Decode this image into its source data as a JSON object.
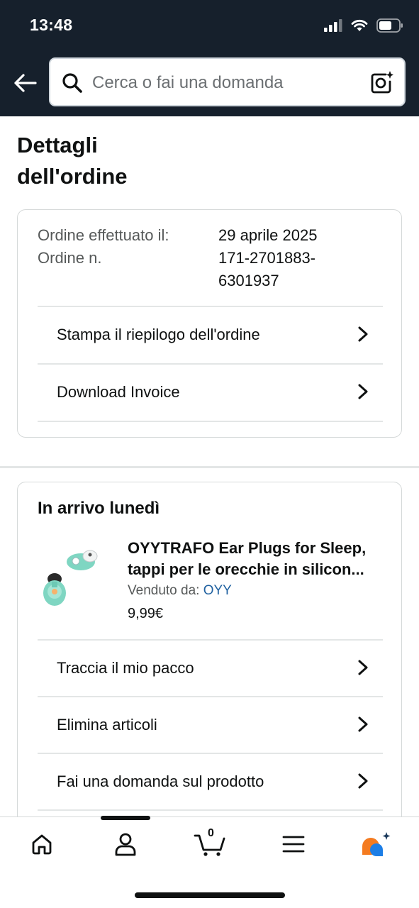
{
  "status_bar": {
    "time": "13:48"
  },
  "search": {
    "placeholder": "Cerca o fai una domanda"
  },
  "page": {
    "title": "Dettagli dell'ordine"
  },
  "order_summary": {
    "placed_label": "Ordine effettuato il:",
    "placed_value": "29 aprile 2025",
    "number_label": "Ordine n.",
    "number_value": "171-2701883-6301937",
    "actions": [
      {
        "label": "Stampa il riepilogo dell'ordine"
      },
      {
        "label": "Download Invoice"
      }
    ]
  },
  "delivery": {
    "title": "In arrivo lunedì",
    "product": {
      "name": "OYYTRAFO Ear Plugs for Sleep, tappi per le orecchie in silicon...",
      "seller_label": "Venduto da:",
      "seller_name": "OYY",
      "price": "9,99€"
    },
    "actions": [
      {
        "label": "Traccia il mio pacco"
      },
      {
        "label": "Elimina articoli"
      },
      {
        "label": "Fai una domanda sul prodotto"
      }
    ]
  },
  "bottom_nav": {
    "items": [
      "home-icon",
      "account-icon",
      "cart-icon",
      "menu-icon",
      "rufus-icon"
    ],
    "cart_count": "0"
  },
  "colors": {
    "header_bg": "#16202c",
    "link": "#2162a1",
    "rufus_orange": "#f47b20",
    "rufus_blue": "#1c7ee6"
  }
}
